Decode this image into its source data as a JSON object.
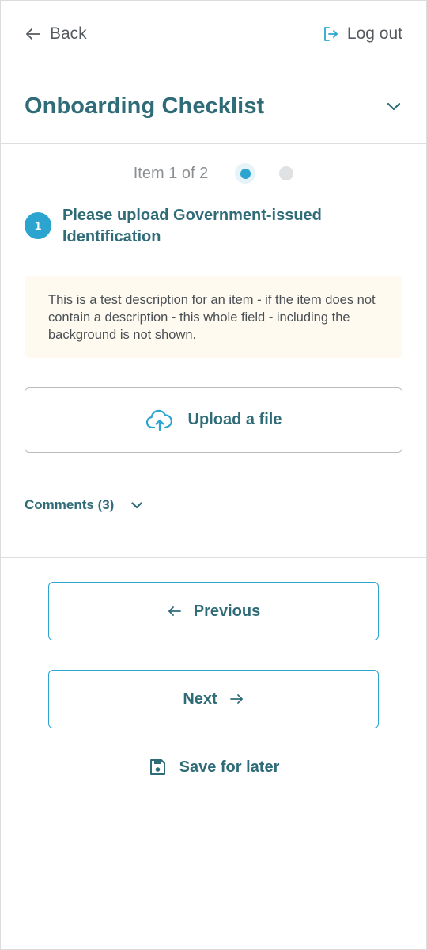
{
  "topbar": {
    "back_label": "Back",
    "logout_label": "Log out"
  },
  "header": {
    "title": "Onboarding Checklist"
  },
  "pager": {
    "label": "Item 1 of 2",
    "current": 1,
    "total": 2
  },
  "item": {
    "number": "1",
    "title": "Please upload Government-issued Identification",
    "description": "This is a test description for an item - if the item does not contain a description - this whole field - including the background is not shown."
  },
  "upload": {
    "label": "Upload a file"
  },
  "comments": {
    "label": "Comments (3)"
  },
  "nav": {
    "previous_label": "Previous",
    "next_label": "Next",
    "save_label": "Save for later"
  },
  "icons": {
    "back": "arrow-left-icon",
    "logout": "logout-icon",
    "collapse": "chevron-down-icon",
    "upload": "cloud-upload-icon",
    "save": "floppy-disk-icon"
  },
  "colors": {
    "primary": "#2f6c78",
    "accent": "#2ba5d0",
    "description_bg": "#fefaef",
    "muted_text": "#8b8f93"
  }
}
